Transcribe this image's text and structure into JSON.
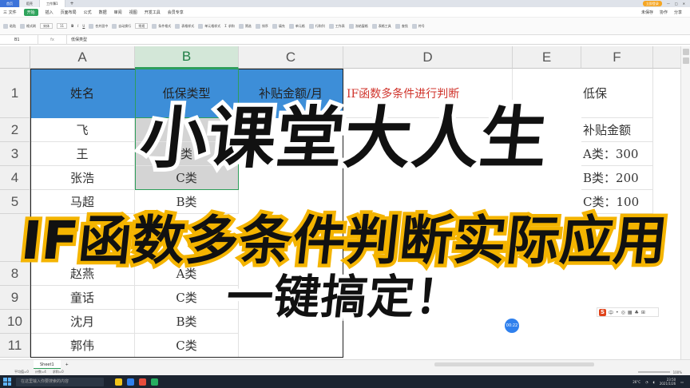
{
  "browser_tabs": [
    "首页",
    "稻壳",
    "工作簿1"
  ],
  "titlebar_login": "立即登录",
  "menu": [
    "三 文件",
    "开始",
    "插入",
    "页面布局",
    "公式",
    "数据",
    "审阅",
    "视图",
    "开发工具",
    "会员专享"
  ],
  "menu_right": [
    "未保存",
    "协作",
    "分享"
  ],
  "ribbon": {
    "font": "宋体",
    "size": "11",
    "items": [
      "粘贴",
      "格式刷",
      "合并居中",
      "自动换行",
      "常规",
      "条件格式",
      "表格样式",
      "单元格样式",
      "求和",
      "筛选",
      "排序",
      "填充",
      "单元格",
      "行和列",
      "工作表",
      "冻结窗格",
      "表格工具",
      "查找",
      "符号"
    ]
  },
  "formula_bar": {
    "cell_ref": "B1",
    "fx": "fx",
    "content": "低保类型"
  },
  "columns": [
    "A",
    "B",
    "C",
    "D",
    "E",
    "F"
  ],
  "rows": [
    "1",
    "2",
    "3",
    "4",
    "5",
    "8",
    "9",
    "10",
    "11"
  ],
  "table": {
    "h_name": "姓名",
    "h_type": "低保类型",
    "h_amount": "补贴金额/月",
    "d1": "IF函数多条件进行判断",
    "names": [
      "飞",
      "王",
      "张浩",
      "马超",
      "赵燕",
      "童话",
      "沈月",
      "郭伟"
    ],
    "types": [
      "",
      "类",
      "C类",
      "B类",
      "A类",
      "C类",
      "B类",
      "C类"
    ]
  },
  "sidebar_f": [
    "低保",
    "补贴金额",
    "A类：300",
    "B类：200",
    "C类：100"
  ],
  "sheet_tab": "Sheet1",
  "status": [
    "平均值=0",
    "计数=4",
    "求和=0"
  ],
  "zoom": "100%",
  "bubble": "00:22",
  "taskbar": {
    "search": "在这里输入你要搜索的内容",
    "time": "23:50",
    "date": "2021/1/26",
    "temp": "26°C"
  },
  "overlay": {
    "title": "小课堂大人生",
    "subtitle": "IF函数多条件判断实际应用",
    "tagline": "一键搞定！"
  },
  "colors": {
    "header_blue": "#3d8ed8",
    "select_green": "#2e9e5b",
    "red_text": "#d0342c",
    "overlay_yellow": "#f4b400"
  }
}
